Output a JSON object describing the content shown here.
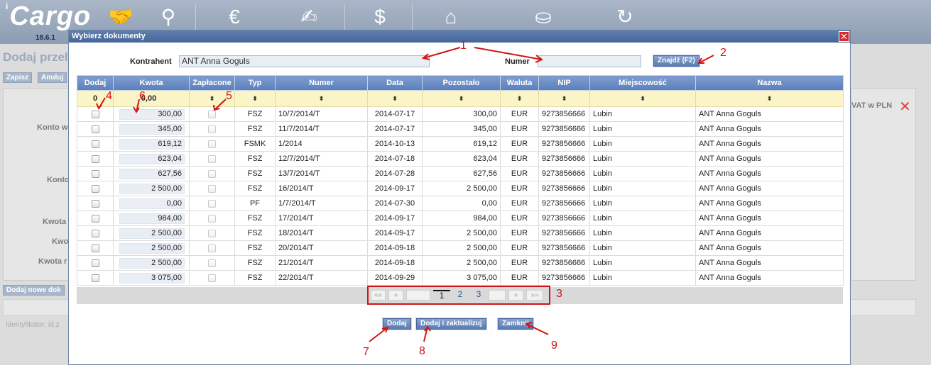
{
  "app": {
    "logo": "Cargo",
    "logo_prefix": "i",
    "version": "18.6.1",
    "top_icons": [
      "handshake-icon",
      "magnifier-icon",
      "invoice-euro-icon",
      "signed-document-icon",
      "money-bag-icon",
      "bank-icon",
      "coins-icon",
      "euro-refresh-icon"
    ]
  },
  "background": {
    "title": "Dodaj przel",
    "buttons": [
      "Zapisz",
      "Anuluj"
    ],
    "labels": [
      "Konto w",
      "Konto",
      "Kwota",
      "Kwo",
      "Kwota r"
    ],
    "vat_label": "VAT w PLN",
    "add_doc_button": "Dodaj nowe dok",
    "identifier": "Identyfikator: id.z"
  },
  "modal": {
    "title": "Wybierz dokumenty",
    "close": "✕",
    "kontrahent_label": "Kontrahent",
    "kontrahent_value": "ANT Anna Goguls",
    "numer_label": "Numer",
    "numer_value": "",
    "find_button": "Znajdź (F2)",
    "columns": [
      "Dodaj",
      "Kwota",
      "Zapłacone",
      "Typ",
      "Numer",
      "Data",
      "Pozostało",
      "Waluta",
      "NIP",
      "Miejscowość",
      "Nazwa"
    ],
    "filter": {
      "dodaj_count": "0",
      "kwota_sum": "0,00",
      "sort_symbol": "⬍"
    },
    "rows": [
      {
        "kwota": "300,00",
        "typ": "FSZ",
        "numer": "10/7/2014/T",
        "data": "2014-07-17",
        "pozostalo": "300,00",
        "waluta": "EUR",
        "nip": "9273856666",
        "miejscowosc": "Lubin",
        "nazwa": "ANT Anna Goguls"
      },
      {
        "kwota": "345,00",
        "typ": "FSZ",
        "numer": "11/7/2014/T",
        "data": "2014-07-17",
        "pozostalo": "345,00",
        "waluta": "EUR",
        "nip": "9273856666",
        "miejscowosc": "Lubin",
        "nazwa": "ANT Anna Goguls"
      },
      {
        "kwota": "619,12",
        "typ": "FSMK",
        "numer": "1/2014",
        "data": "2014-10-13",
        "pozostalo": "619,12",
        "waluta": "EUR",
        "nip": "9273856666",
        "miejscowosc": "Lubin",
        "nazwa": "ANT Anna Goguls"
      },
      {
        "kwota": "623,04",
        "typ": "FSZ",
        "numer": "12/7/2014/T",
        "data": "2014-07-18",
        "pozostalo": "623,04",
        "waluta": "EUR",
        "nip": "9273856666",
        "miejscowosc": "Lubin",
        "nazwa": "ANT Anna Goguls"
      },
      {
        "kwota": "627,56",
        "typ": "FSZ",
        "numer": "13/7/2014/T",
        "data": "2014-07-28",
        "pozostalo": "627,56",
        "waluta": "EUR",
        "nip": "9273856666",
        "miejscowosc": "Lubin",
        "nazwa": "ANT Anna Goguls"
      },
      {
        "kwota": "2 500,00",
        "typ": "FSZ",
        "numer": "16/2014/T",
        "data": "2014-09-17",
        "pozostalo": "2 500,00",
        "waluta": "EUR",
        "nip": "9273856666",
        "miejscowosc": "Lubin",
        "nazwa": "ANT Anna Goguls"
      },
      {
        "kwota": "0,00",
        "typ": "PF",
        "numer": "1/7/2014/T",
        "data": "2014-07-30",
        "pozostalo": "0,00",
        "waluta": "EUR",
        "nip": "9273856666",
        "miejscowosc": "Lubin",
        "nazwa": "ANT Anna Goguls"
      },
      {
        "kwota": "984,00",
        "typ": "FSZ",
        "numer": "17/2014/T",
        "data": "2014-09-17",
        "pozostalo": "984,00",
        "waluta": "EUR",
        "nip": "9273856666",
        "miejscowosc": "Lubin",
        "nazwa": "ANT Anna Goguls"
      },
      {
        "kwota": "2 500,00",
        "typ": "FSZ",
        "numer": "18/2014/T",
        "data": "2014-09-17",
        "pozostalo": "2 500,00",
        "waluta": "EUR",
        "nip": "9273856666",
        "miejscowosc": "Lubin",
        "nazwa": "ANT Anna Goguls"
      },
      {
        "kwota": "2 500,00",
        "typ": "FSZ",
        "numer": "20/2014/T",
        "data": "2014-09-18",
        "pozostalo": "2 500,00",
        "waluta": "EUR",
        "nip": "9273856666",
        "miejscowosc": "Lubin",
        "nazwa": "ANT Anna Goguls"
      },
      {
        "kwota": "2 500,00",
        "typ": "FSZ",
        "numer": "21/2014/T",
        "data": "2014-09-18",
        "pozostalo": "2 500,00",
        "waluta": "EUR",
        "nip": "9273856666",
        "miejscowosc": "Lubin",
        "nazwa": "ANT Anna Goguls"
      },
      {
        "kwota": "3 075,00",
        "typ": "FSZ",
        "numer": "22/2014/T",
        "data": "2014-09-29",
        "pozostalo": "3 075,00",
        "waluta": "EUR",
        "nip": "9273856666",
        "miejscowosc": "Lubin",
        "nazwa": "ANT Anna Goguls"
      }
    ],
    "pager": {
      "first": "««",
      "prev": "«",
      "pages": [
        "1",
        "2",
        "3"
      ],
      "current": "1",
      "next": "»",
      "last": "»»"
    },
    "buttons": {
      "add": "Dodaj",
      "add_update": "Dodaj i zaktualizuj",
      "close": "Zamknij"
    }
  },
  "annotations": [
    "1",
    "2",
    "3",
    "4",
    "5",
    "6",
    "7",
    "8",
    "9"
  ],
  "colors": {
    "accent": "#5c7fba",
    "annotation": "#d01515",
    "filter_row": "#fbf4c6"
  }
}
